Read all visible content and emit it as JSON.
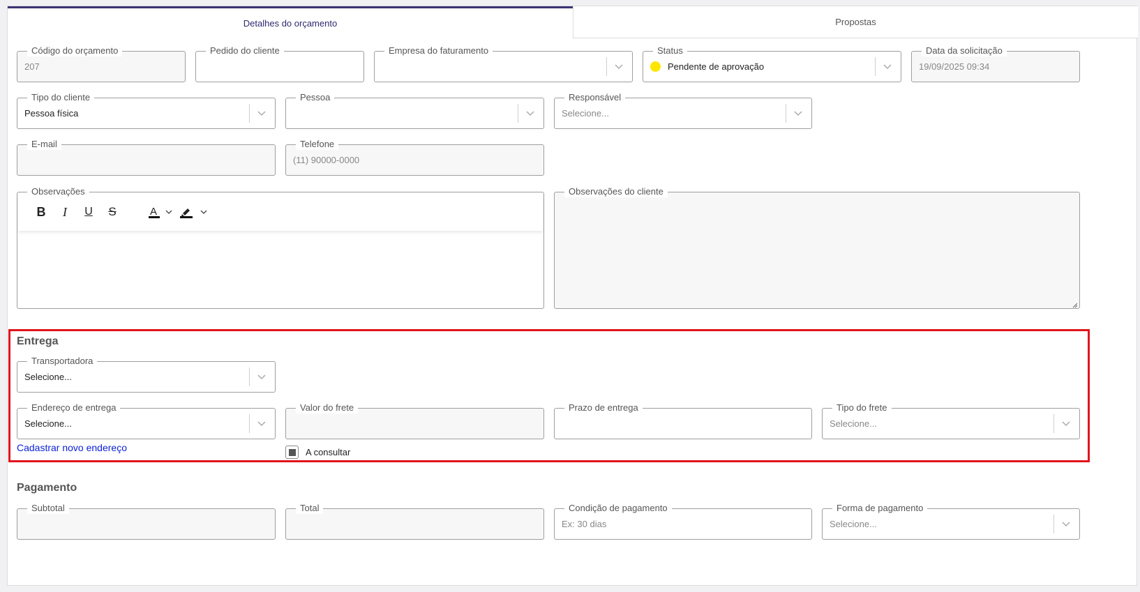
{
  "tabs": {
    "details": "Detalhes do orçamento",
    "proposals": "Propostas"
  },
  "row1": {
    "codigo": {
      "label": "Código do orçamento",
      "value": "207"
    },
    "pedido": {
      "label": "Pedido do cliente",
      "value": ""
    },
    "empresa": {
      "label": "Empresa do faturamento",
      "value": ""
    },
    "status": {
      "label": "Status",
      "value": "Pendente de aprovação",
      "dot_color": "#ffe600"
    },
    "data": {
      "label": "Data da solicitação",
      "value": "19/09/2025 09:34"
    }
  },
  "row2": {
    "tipo_cliente": {
      "label": "Tipo do cliente",
      "value": "Pessoa física"
    },
    "pessoa": {
      "label": "Pessoa",
      "value": ""
    },
    "responsavel": {
      "label": "Responsável",
      "placeholder": "Selecione..."
    }
  },
  "row3": {
    "email": {
      "label": "E-mail",
      "value": ""
    },
    "telefone": {
      "label": "Telefone",
      "placeholder": "(11) 90000-0000"
    }
  },
  "observacoes": {
    "label": "Observações",
    "value": ""
  },
  "observacoes_cliente": {
    "label": "Observações do cliente",
    "value": ""
  },
  "entrega": {
    "title": "Entrega",
    "transportadora": {
      "label": "Transportadora",
      "value": "Selecione..."
    },
    "endereco": {
      "label": "Endereço de entrega",
      "value": "Selecione..."
    },
    "valor_frete": {
      "label": "Valor do frete",
      "value": ""
    },
    "prazo": {
      "label": "Prazo de entrega",
      "value": ""
    },
    "tipo_frete": {
      "label": "Tipo do frete",
      "placeholder": "Selecione..."
    },
    "novo_endereco_link": "Cadastrar novo endereço",
    "a_consultar": "A consultar",
    "highlight_color": "#e0141c"
  },
  "pagamento": {
    "title": "Pagamento",
    "subtotal": {
      "label": "Subtotal",
      "value": ""
    },
    "total": {
      "label": "Total",
      "value": ""
    },
    "condicao": {
      "label": "Condição de pagamento",
      "placeholder": "Ex: 30 dias"
    },
    "forma": {
      "label": "Forma de pagamento",
      "placeholder": "Selecione..."
    }
  }
}
